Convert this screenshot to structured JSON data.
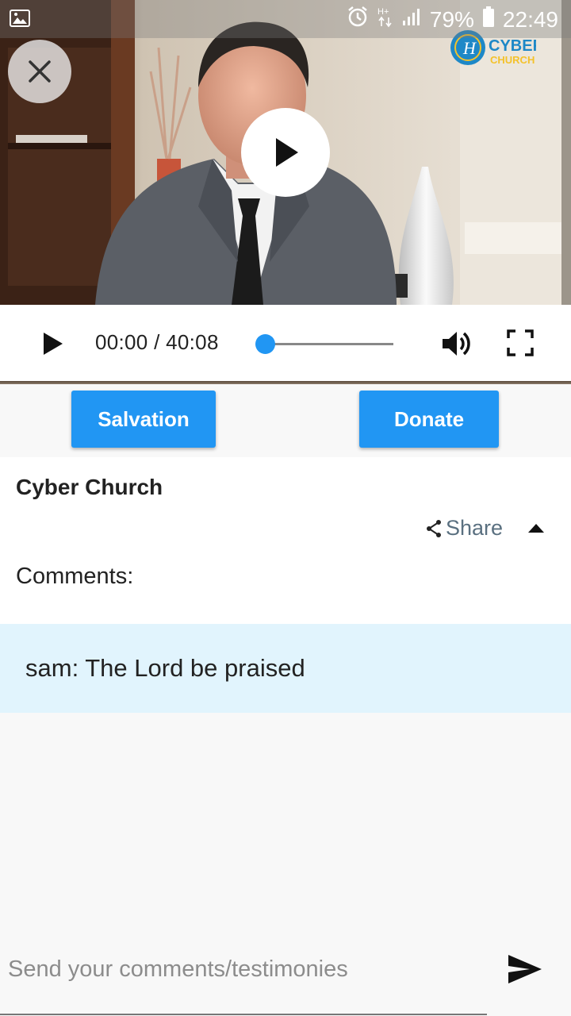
{
  "status_bar": {
    "left_icon": "image-icon",
    "battery_percent": "79%",
    "time": "22:49",
    "icons": [
      "alarm-icon",
      "hplus-data-icon",
      "signal-icon",
      "battery-icon"
    ]
  },
  "video": {
    "logo_text": "CYBER CHURCH",
    "close_icon": "close-icon",
    "play_icon": "play-icon"
  },
  "player": {
    "time_display": "00:00 / 40:08",
    "progress_fraction": 0,
    "colors": {
      "accent": "#2196f3"
    }
  },
  "actions": {
    "salvation_label": "Salvation",
    "donate_label": "Donate"
  },
  "info": {
    "channel_name": "Cyber Church",
    "share_label": "Share",
    "comments_label": "Comments:"
  },
  "comments": [
    {
      "text": "sam: The Lord be praised"
    }
  ],
  "composer": {
    "placeholder": "Send your comments/testimonies"
  }
}
